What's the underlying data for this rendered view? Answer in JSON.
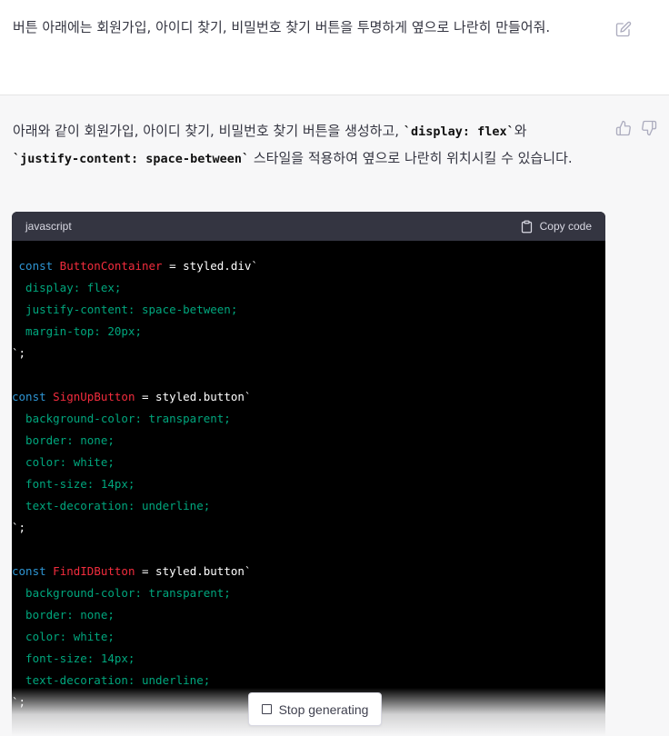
{
  "user_message": {
    "text": "버튼 아래에는 회원가입, 아이디 찾기, 비밀번호 찾기 버튼을 투명하게 옆으로 나란히 만들어줘."
  },
  "assistant_message": {
    "text_before_code1": "아래와 같이 회원가입, 아이디 찾기, 비밀번호 찾기 버튼을 생성하고, ",
    "code1": "`display: flex`",
    "text_between": "와 ",
    "code2": "`justify-content: space-between`",
    "text_after": " 스타일을 적용하여 옆으로 나란히 위치시킬 수 있습니다."
  },
  "code_block": {
    "language": "javascript",
    "copy_label": "Copy code",
    "lines": [
      [
        {
          "t": " const",
          "c": "kw"
        },
        {
          "t": " ButtonContainer",
          "c": "cls"
        },
        {
          "t": " = styled.div`"
        }
      ],
      [
        {
          "t": "  display: flex;",
          "c": "str"
        }
      ],
      [
        {
          "t": "  justify-content: space-between;",
          "c": "str"
        }
      ],
      [
        {
          "t": "  margin-top: 20px;",
          "c": "str"
        }
      ],
      [
        {
          "t": "`;"
        }
      ],
      [],
      [
        {
          "t": "const",
          "c": "kw"
        },
        {
          "t": " SignUpButton",
          "c": "cls"
        },
        {
          "t": " = styled.button`"
        }
      ],
      [
        {
          "t": "  background-color: transparent;",
          "c": "str"
        }
      ],
      [
        {
          "t": "  border: none;",
          "c": "str"
        }
      ],
      [
        {
          "t": "  color: white;",
          "c": "str"
        }
      ],
      [
        {
          "t": "  font-size: 14px;",
          "c": "str"
        }
      ],
      [
        {
          "t": "  text-decoration: underline;",
          "c": "str"
        }
      ],
      [
        {
          "t": "`;"
        }
      ],
      [],
      [
        {
          "t": "const",
          "c": "kw"
        },
        {
          "t": " FindIDButton",
          "c": "cls"
        },
        {
          "t": " = styled.button`"
        }
      ],
      [
        {
          "t": "  background-color: transparent;",
          "c": "str"
        }
      ],
      [
        {
          "t": "  border: none;",
          "c": "str"
        }
      ],
      [
        {
          "t": "  color: white;",
          "c": "str"
        }
      ],
      [
        {
          "t": "  font-size: 14px;",
          "c": "str"
        }
      ],
      [
        {
          "t": "  text-decoration: underline;",
          "c": "str"
        }
      ],
      [
        {
          "t": "`;"
        }
      ]
    ]
  },
  "stop_button": {
    "label": "Stop generating"
  },
  "colors": {
    "keyword": "#2e95d3",
    "class_name": "#f22c3d",
    "string": "#00a67d",
    "code_bg": "#000000",
    "code_header_bg": "#343541"
  },
  "icons": [
    "edit-icon",
    "thumbs-up-icon",
    "thumbs-down-icon",
    "clipboard-icon",
    "stop-icon"
  ]
}
